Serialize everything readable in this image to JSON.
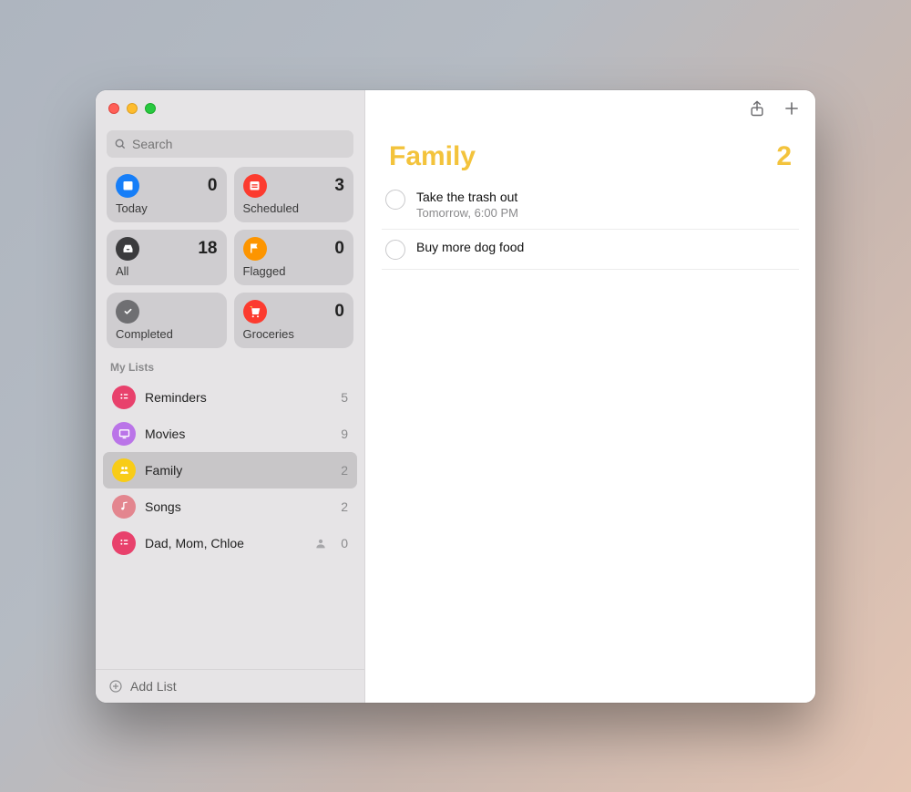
{
  "search": {
    "placeholder": "Search"
  },
  "smart": [
    {
      "id": "today",
      "label": "Today",
      "count": 0,
      "bg": "#167ef8",
      "icon": "calendar"
    },
    {
      "id": "scheduled",
      "label": "Scheduled",
      "count": 3,
      "bg": "#fc3b2f",
      "icon": "calendar-lines"
    },
    {
      "id": "all",
      "label": "All",
      "count": 18,
      "bg": "#3b3b3d",
      "icon": "tray"
    },
    {
      "id": "flagged",
      "label": "Flagged",
      "count": 0,
      "bg": "#fd9500",
      "icon": "flag"
    },
    {
      "id": "completed",
      "label": "Completed",
      "count": "",
      "bg": "#6f6f72",
      "icon": "check"
    },
    {
      "id": "groceries",
      "label": "Groceries",
      "count": 0,
      "bg": "#fc3b2f",
      "icon": "cart"
    }
  ],
  "sectionTitle": "My Lists",
  "lists": [
    {
      "id": "reminders",
      "name": "Reminders",
      "count": 5,
      "bg": "#e8416c",
      "icon": "bullet",
      "shared": false,
      "selected": false
    },
    {
      "id": "movies",
      "name": "Movies",
      "count": 9,
      "bg": "#ba74e8",
      "icon": "screen",
      "shared": false,
      "selected": false
    },
    {
      "id": "family",
      "name": "Family",
      "count": 2,
      "bg": "#f8cc18",
      "icon": "people",
      "shared": false,
      "selected": true
    },
    {
      "id": "songs",
      "name": "Songs",
      "count": 2,
      "bg": "#e3868f",
      "icon": "music",
      "shared": false,
      "selected": false
    },
    {
      "id": "dadmom",
      "name": "Dad, Mom, Chloe",
      "count": 0,
      "bg": "#e8416c",
      "icon": "bullet",
      "shared": true,
      "selected": false
    }
  ],
  "addListLabel": "Add List",
  "main": {
    "title": "Family",
    "count": 2,
    "accent": "#f3c33c",
    "items": [
      {
        "title": "Take the trash out",
        "subtitle": "Tomorrow, 6:00 PM"
      },
      {
        "title": "Buy more dog food",
        "subtitle": ""
      }
    ]
  }
}
